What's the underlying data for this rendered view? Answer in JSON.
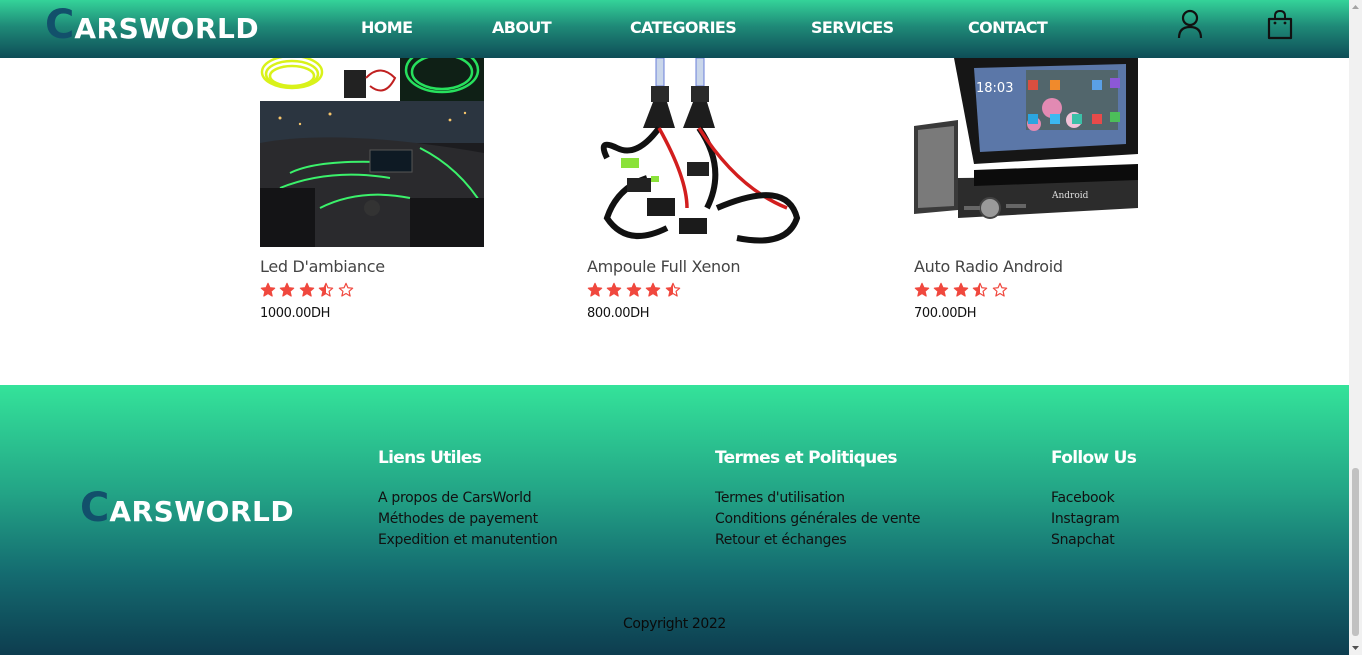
{
  "header": {
    "logo_first": "C",
    "logo_rest": "ARSWORLD",
    "nav": [
      {
        "label": "HOME"
      },
      {
        "label": "ABOUT"
      },
      {
        "label": "CATEGORIES"
      },
      {
        "label": "SERVICES"
      },
      {
        "label": "CONTACT"
      }
    ],
    "icons": [
      "user-icon",
      "shopping-bag-icon"
    ]
  },
  "products": [
    {
      "name": "Led D'ambiance",
      "rating": 3.5,
      "rating_max": 5,
      "price": "1000.00DH"
    },
    {
      "name": "Ampoule Full Xenon",
      "rating": 4.5,
      "rating_max": 5,
      "price": "800.00DH"
    },
    {
      "name": "Auto Radio Android",
      "rating": 3.5,
      "rating_max": 5,
      "price": "700.00DH"
    }
  ],
  "footer": {
    "logo_first": "C",
    "logo_rest": "ARSWORLD",
    "columns": [
      {
        "title": "Liens Utiles",
        "links": [
          "A propos de CarsWorld",
          "Méthodes de payement",
          "Expedition et manutention"
        ]
      },
      {
        "title": "Termes et Politiques",
        "links": [
          "Termes d'utilisation",
          "Conditions générales de vente",
          "Retour et échanges"
        ]
      },
      {
        "title": "Follow Us",
        "links": [
          "Facebook",
          "Instagram",
          "Snapchat"
        ]
      }
    ],
    "copyright": "Copyright 2022"
  },
  "radio_screen": {
    "time": "18:03",
    "brand": "Android"
  },
  "colors": {
    "accent_green": "#34d399",
    "dark_teal": "#0e4d57",
    "logo_c": "#12506b",
    "star": "#f0483e"
  }
}
